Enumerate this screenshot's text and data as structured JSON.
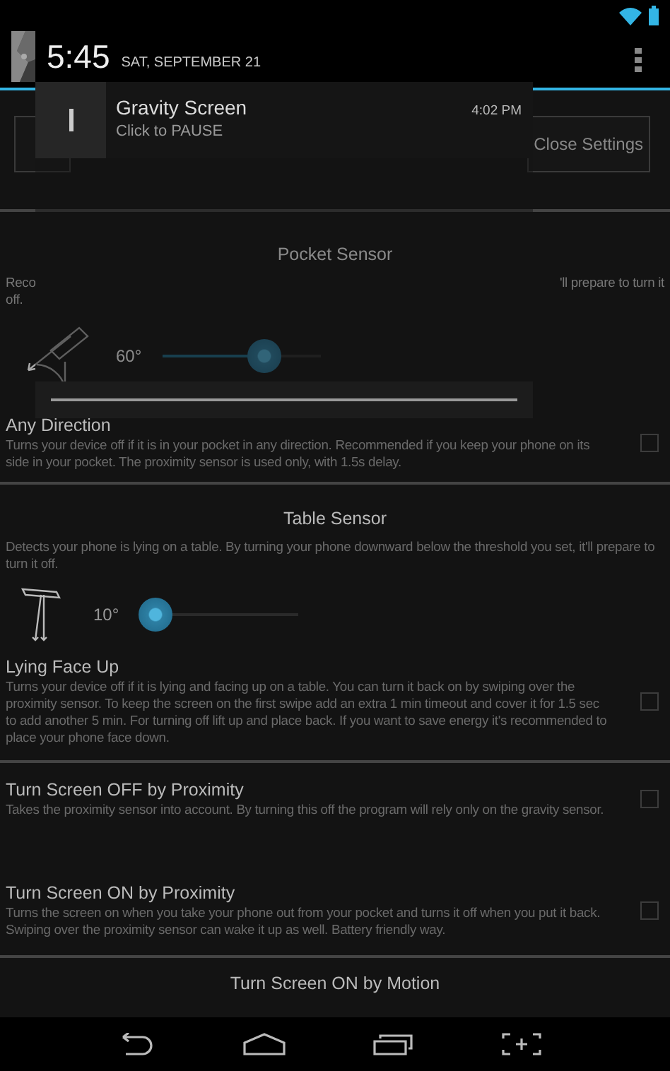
{
  "action_bar": {
    "close_button": "Close Settings"
  },
  "sections": [
    {
      "kind": "sensor",
      "title": "Pocket Sensor",
      "description_parts": [
        "Reco",
        "'ll prepare to turn it",
        "off."
      ],
      "angle": "60°",
      "level": 0.64
    },
    {
      "kind": "option",
      "title": "Any Direction",
      "description": "Turns your device off if it is in your pocket in any direction. Recommended if you keep your phone on its side in your pocket. The proximity sensor is used only, with 1.5s delay.",
      "checked": false,
      "divider": true
    },
    {
      "kind": "sensor",
      "title": "Table Sensor",
      "description": "Detects your phone is lying on a table. By turning your phone downward below the threshold you set, it'll prepare to turn it off.",
      "angle": "10°",
      "level": 0.1
    },
    {
      "kind": "option",
      "title": "Lying Face Up",
      "description": "Turns your device off if it is lying and facing up on a table. You can turn it back on by swiping over the proximity sensor. To keep the screen on the first swipe add an extra 1 min timeout and cover it for 1.5 sec to add another 5 min. For turning off lift up and place back. If you want to save energy it's recommended to place your phone face down.",
      "checked": false,
      "divider": true
    },
    {
      "kind": "option",
      "title": "Turn Screen OFF by Proximity",
      "description": "Takes the proximity sensor into account. By turning this off the program will rely only on the gravity sensor.",
      "checked": false,
      "divider": false
    },
    {
      "kind": "option",
      "title": "Turn Screen ON by Proximity",
      "description": "Turns the screen on when you take your phone out from your pocket and turns it off when you put it back. Swiping over the proximity sensor can wake it up as well. Battery friendly way.",
      "checked": false,
      "divider": true
    },
    {
      "kind": "heading",
      "title": "Turn Screen ON by Motion"
    }
  ],
  "notification_shade": {
    "time": "5:45",
    "date": "SAT, SEPTEMBER 21",
    "notifications": [
      {
        "title": "Gravity Screen",
        "text": "Click to PAUSE",
        "time": "4:02 PM"
      }
    ]
  }
}
